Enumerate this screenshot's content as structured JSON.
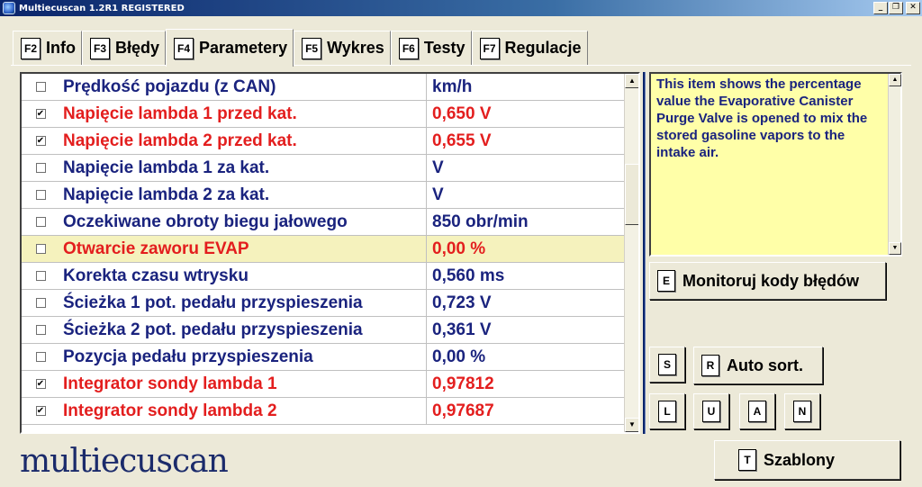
{
  "window": {
    "title": "Multiecuscan 1.2R1 REGISTERED"
  },
  "tabs": [
    {
      "key": "F2",
      "label": "Info"
    },
    {
      "key": "F3",
      "label": "Błędy"
    },
    {
      "key": "F4",
      "label": "Parametery"
    },
    {
      "key": "F5",
      "label": "Wykres"
    },
    {
      "key": "F6",
      "label": "Testy"
    },
    {
      "key": "F7",
      "label": "Regulacje"
    }
  ],
  "params": [
    {
      "checked": false,
      "name": "Prędkość pojazdu (z CAN)",
      "value": "km/h",
      "color": "blue"
    },
    {
      "checked": true,
      "name": "Napięcie lambda 1 przed kat.",
      "value": "0,650 V",
      "color": "red"
    },
    {
      "checked": true,
      "name": "Napięcie lambda 2 przed kat.",
      "value": "0,655 V",
      "color": "red"
    },
    {
      "checked": false,
      "name": "Napięcie lambda 1 za kat.",
      "value": "V",
      "color": "blue"
    },
    {
      "checked": false,
      "name": "Napięcie lambda 2 za kat.",
      "value": "V",
      "color": "blue"
    },
    {
      "checked": false,
      "name": "Oczekiwane obroty biegu jałowego",
      "value": "850 obr/min",
      "color": "blue"
    },
    {
      "checked": false,
      "name": "Otwarcie zaworu EVAP",
      "value": "0,00 %",
      "color": "red",
      "selected": true
    },
    {
      "checked": false,
      "name": "Korekta czasu wtrysku",
      "value": "0,560 ms",
      "color": "blue"
    },
    {
      "checked": false,
      "name": "Ścieżka 1 pot. pedału przyspieszenia",
      "value": "0,723 V",
      "color": "blue"
    },
    {
      "checked": false,
      "name": "Ścieżka 2 pot. pedału przyspieszenia",
      "value": "0,361 V",
      "color": "blue"
    },
    {
      "checked": false,
      "name": "Pozycja pedału przyspieszenia",
      "value": "0,00 %",
      "color": "blue"
    },
    {
      "checked": true,
      "name": "Integrator sondy lambda 1",
      "value": "0,97812",
      "color": "red"
    },
    {
      "checked": true,
      "name": "Integrator sondy lambda 2",
      "value": "0,97687",
      "color": "red"
    }
  ],
  "description": "This item shows the percentage value the Evaporative Canister Purge Valve is opened to mix the stored gasoline vapors to the intake air.",
  "buttons": {
    "monitor": {
      "key": "E",
      "label": "Monitoruj kody błędów"
    },
    "s": {
      "key": "S"
    },
    "autosort": {
      "key": "R",
      "label": "Auto sort."
    },
    "l": {
      "key": "L"
    },
    "u": {
      "key": "U"
    },
    "a": {
      "key": "A"
    },
    "n": {
      "key": "N"
    },
    "templates": {
      "key": "T",
      "label": "Szablony"
    }
  },
  "logo": "multiecuscan",
  "window_buttons": {
    "minimize": "_",
    "restore": "❐",
    "close": "✕"
  },
  "scrollbar": {
    "up": "▲",
    "down": "▼"
  },
  "checkmark": "✔"
}
